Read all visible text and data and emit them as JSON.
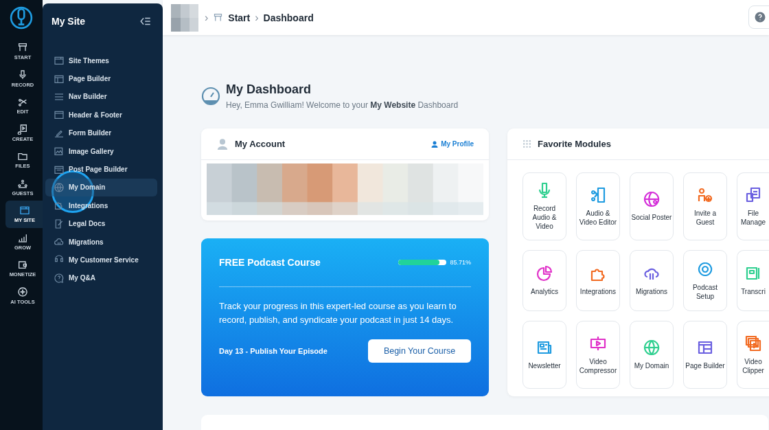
{
  "rail": {
    "items": [
      {
        "label": "START",
        "selected": false
      },
      {
        "label": "RECORD",
        "selected": false
      },
      {
        "label": "EDIT",
        "selected": false
      },
      {
        "label": "CREATE",
        "selected": false
      },
      {
        "label": "FILES",
        "selected": false
      },
      {
        "label": "GUESTS",
        "selected": false
      },
      {
        "label": "MY SITE",
        "selected": true
      },
      {
        "label": "GROW",
        "selected": false
      },
      {
        "label": "MONETIZE",
        "selected": false
      },
      {
        "label": "AI TOOLS",
        "selected": false
      }
    ]
  },
  "sidebar": {
    "title": "My Site",
    "items": [
      {
        "label": "Site Themes",
        "selected": false
      },
      {
        "label": "Page Builder",
        "selected": false
      },
      {
        "label": "Nav Builder",
        "selected": false
      },
      {
        "label": "Header & Footer",
        "selected": false
      },
      {
        "label": "Form Builder",
        "selected": false
      },
      {
        "label": "Image Gallery",
        "selected": false
      },
      {
        "label": "Post Page Builder",
        "selected": false
      },
      {
        "label": "My Domain",
        "selected": true
      },
      {
        "label": "Integrations",
        "selected": false
      },
      {
        "label": "Legal Docs",
        "selected": false
      },
      {
        "label": "Migrations",
        "selected": false
      },
      {
        "label": "My Customer Service",
        "selected": false
      },
      {
        "label": "My Q&A",
        "selected": false
      }
    ]
  },
  "breadcrumb": {
    "separator": "›",
    "items": [
      "Start",
      "Dashboard"
    ]
  },
  "header": {
    "title": "My Dashboard",
    "subtitle": "Hey, Emma Gwilliam! Welcome to your **My Website** Dashboard"
  },
  "account": {
    "title": "My Account",
    "link": "My Profile"
  },
  "course": {
    "title": "FREE Podcast Course",
    "level": 0.8571,
    "reading": "85.71%",
    "text": "Track your progress in this expert-led course as you learn to record, publish, and syndicate your podcast in just 14 days.",
    "day": "Day 13 - Publish Your Episode",
    "button": "Begin Your Course"
  },
  "modules": {
    "title": "Favorite Modules",
    "items": [
      {
        "label": "Record Audio & Video",
        "color": "#2ecf8f"
      },
      {
        "label": "Audio & Video Editor",
        "color": "#1e9be0"
      },
      {
        "label": "Social Poster",
        "color": "#d42ed8"
      },
      {
        "label": "Invite a Guest",
        "color": "#f26a21"
      },
      {
        "label": "File Manage",
        "color": "#6a5fe0"
      },
      {
        "label": "Analytics",
        "color": "#e030c8"
      },
      {
        "label": "Integrations",
        "color": "#f26a21"
      },
      {
        "label": "Migrations",
        "color": "#6a5fe0"
      },
      {
        "label": "Podcast Setup",
        "color": "#1e9be0"
      },
      {
        "label": "Transcri",
        "color": "#2ecf8f"
      },
      {
        "label": "Newsletter",
        "color": "#1e9be0"
      },
      {
        "label": "Video Compressor",
        "color": "#e030c8"
      },
      {
        "label": "My Domain",
        "color": "#2ecf8f"
      },
      {
        "label": "Page Builder",
        "color": "#6a5fe0"
      },
      {
        "label": "Video Clipper",
        "color": "#f26a21"
      }
    ]
  }
}
